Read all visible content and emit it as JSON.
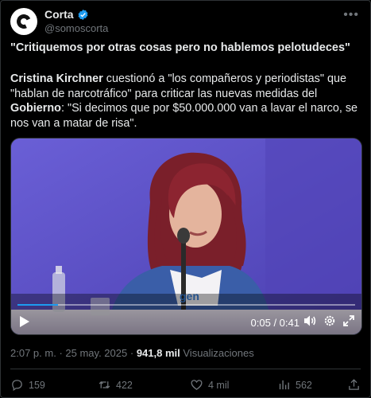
{
  "account": {
    "name": "Corta",
    "handle": "@somoscorta",
    "verified_color": "#1d9bf0"
  },
  "post": {
    "headline": "\"Critiquemos por otras cosas pero no hablemos pelotudeces\"",
    "body_parts": [
      {
        "text": "Cristina Kirchner",
        "bold": true
      },
      {
        "text": " cuestionó a \"los compañeros y periodistas\" que \"hablan de narcotráfico\" para criticar las nuevas medidas del ",
        "bold": false
      },
      {
        "text": "Gobierno",
        "bold": true
      },
      {
        "text": ": \"Si decimos que por $50.000.000 van a lavar el narco, se nos van a matar de risa\".",
        "bold": false
      }
    ]
  },
  "video": {
    "time_display": "0:05 / 0:41",
    "progress_fraction": 0.12,
    "progress_color": "#1d9bf0",
    "background_color": "#5a4fc4",
    "shirt_text": "gen",
    "icons": [
      "play-icon",
      "volume-icon",
      "settings-icon",
      "fullscreen-icon"
    ]
  },
  "meta": {
    "time": "2:07 p. m.",
    "separator": "·",
    "date": "25 may. 2025",
    "views_count": "941,8 mil",
    "views_label": "Visualizaciones"
  },
  "actions": {
    "replies": "159",
    "reposts": "422",
    "likes": "4 mil",
    "bookmarks": "562"
  }
}
